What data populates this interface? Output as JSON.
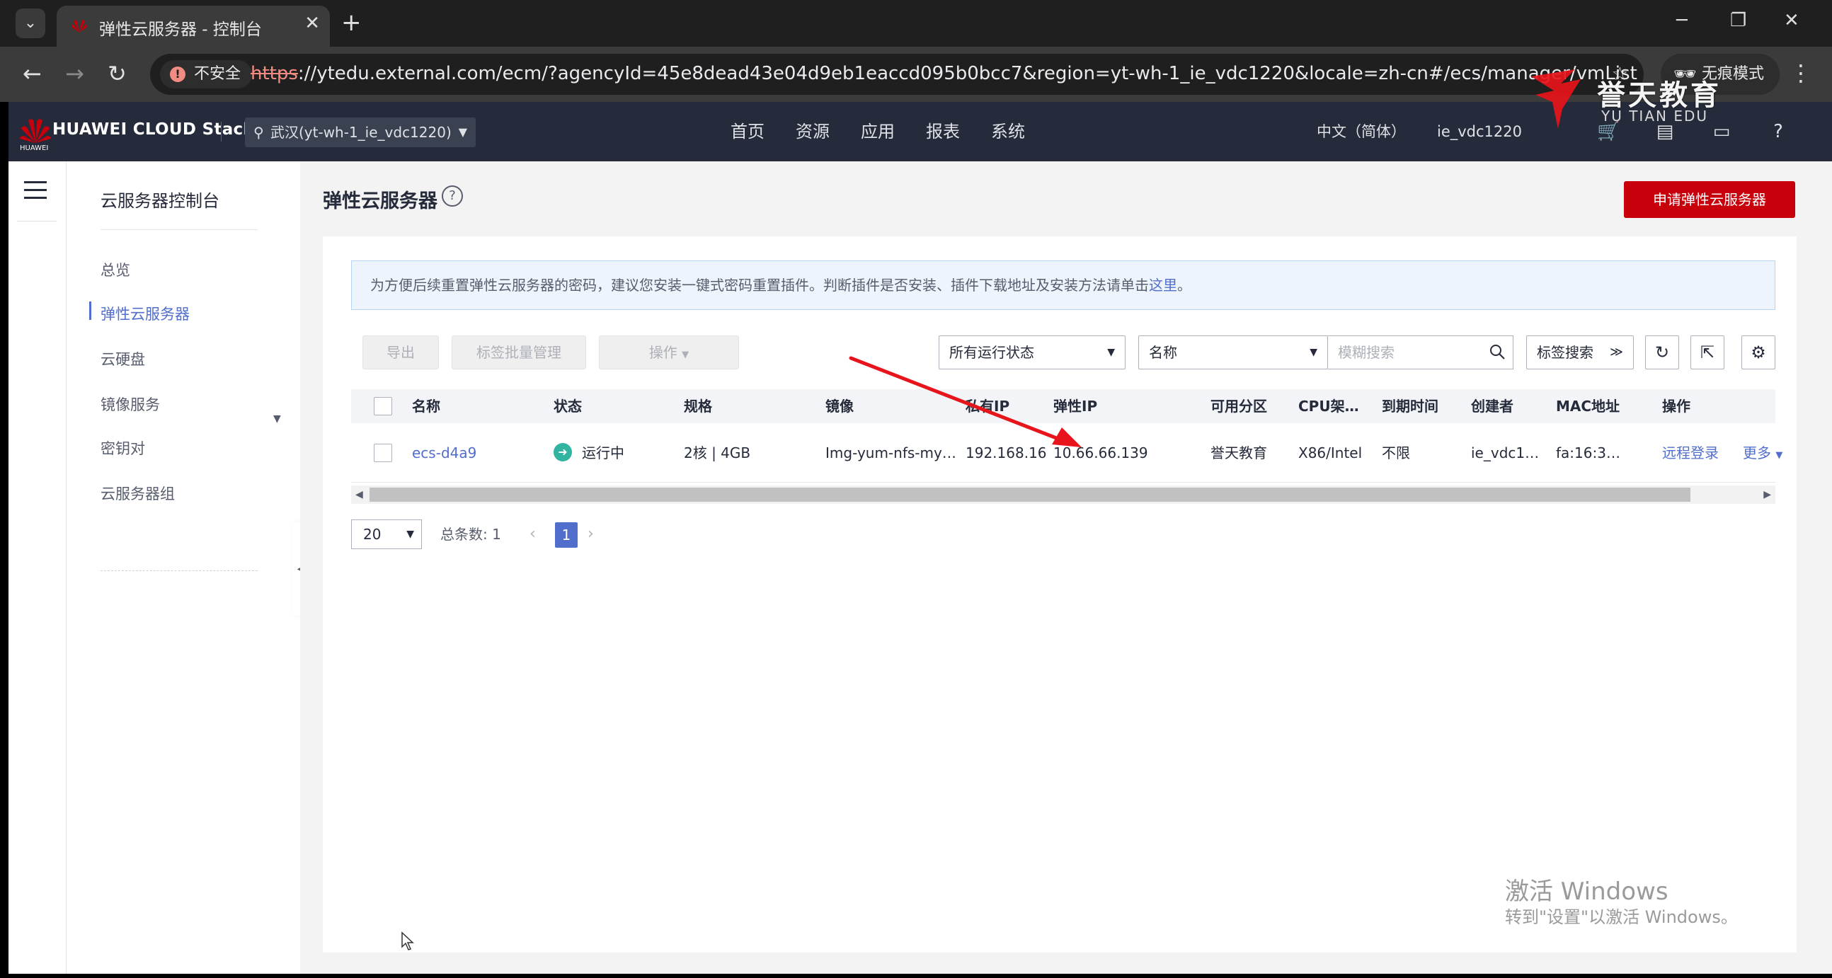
{
  "browser": {
    "tab_title": "弹性云服务器 - 控制台",
    "insecure_label": "不安全",
    "url_scheme": "https",
    "url_rest": "://ytedu.external.com/ecm/?agencyId=45e8dead43e04d9eb1eaccd095b0bcc7&region=yt-wh-1_ie_vdc1220&locale=zh-cn#/ecs/manager/vmList",
    "incognito_label": "无痕模式"
  },
  "watermark": {
    "brand_cn": "誉天教育",
    "brand_en": "YU TIAN EDU"
  },
  "header": {
    "brand": "HUAWEI CLOUD Stack",
    "brand_small": "HUAWEI",
    "region": "武汉(yt-wh-1_ie_vdc1220)",
    "nav": [
      "首页",
      "资源",
      "应用",
      "报表",
      "系统"
    ],
    "language": "中文（简体）",
    "user": "ie_vdc1220"
  },
  "sidebar": {
    "title": "云服务器控制台",
    "items": [
      "总览",
      "弹性云服务器",
      "云硬盘",
      "镜像服务",
      "密钥对",
      "云服务器组"
    ],
    "active_index": 1
  },
  "page": {
    "title": "弹性云服务器",
    "primary_button": "申请弹性云服务器",
    "notice_text": "为方便后续重置弹性云服务器的密码，建议您安装一键式密码重置插件。判断插件是否安装、插件下载地址及安装方法请单击",
    "notice_link": "这里",
    "notice_end": "。"
  },
  "toolbar": {
    "export": "导出",
    "tag_batch": "标签批量管理",
    "operations": "操作",
    "status_filter": "所有运行状态",
    "field_filter": "名称",
    "search_placeholder": "模糊搜索",
    "tag_search": "标签搜索"
  },
  "table": {
    "headers": [
      "名称",
      "状态",
      "规格",
      "镜像",
      "私有IP",
      "弹性IP",
      "可用分区",
      "CPU架…",
      "到期时间",
      "创建者",
      "MAC地址",
      "操作"
    ],
    "rows": [
      {
        "name": "ecs-d4a9",
        "status": "运行中",
        "spec": "2核 | 4GB",
        "image": "Img-yum-nfs-my…",
        "private_ip": "192.168.16",
        "eip": "10.66.66.139",
        "az": "誉天教育",
        "cpu": "X86/Intel",
        "expire": "不限",
        "creator": "ie_vdc1…",
        "mac": "fa:16:3…",
        "action_login": "远程登录",
        "action_more": "更多"
      }
    ]
  },
  "pagination": {
    "page_size": "20",
    "total_label": "总条数:",
    "total": "1",
    "current": "1"
  },
  "windows_watermark": {
    "line1": "激活 Windows",
    "line2": "转到\"设置\"以激活 Windows。"
  },
  "colors": {
    "brand_red": "#c7000b",
    "link_blue": "#526ecc",
    "status_green": "#31b5a0",
    "header_bg": "#252b3a",
    "arrow_red": "#e8141b"
  }
}
